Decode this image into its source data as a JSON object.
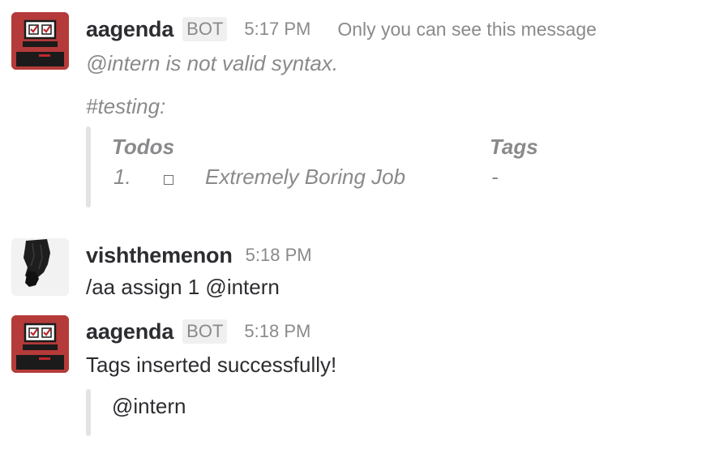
{
  "messages": [
    {
      "user": "aagenda",
      "badge": "BOT",
      "time": "5:17 PM",
      "note": "Only you can see this message",
      "text": "@intern is not valid syntax.",
      "channel": "#testing:",
      "table": {
        "headers": [
          "Todos",
          "Tags"
        ],
        "rows": [
          {
            "index": "1.",
            "checked": false,
            "task": "Extremely Boring Job",
            "tags": "-"
          }
        ]
      }
    },
    {
      "user": "vishthemenon",
      "time": "5:18 PM",
      "text": "/aa assign 1 @intern"
    },
    {
      "user": "aagenda",
      "badge": "BOT",
      "time": "5:18 PM",
      "text": "Tags inserted successfully!",
      "attachment": "@intern"
    }
  ],
  "colors": {
    "bot_avatar": "#b53a3a",
    "muted_text": "#8a8a8d",
    "attachment_bar": "#e3e3e3"
  }
}
